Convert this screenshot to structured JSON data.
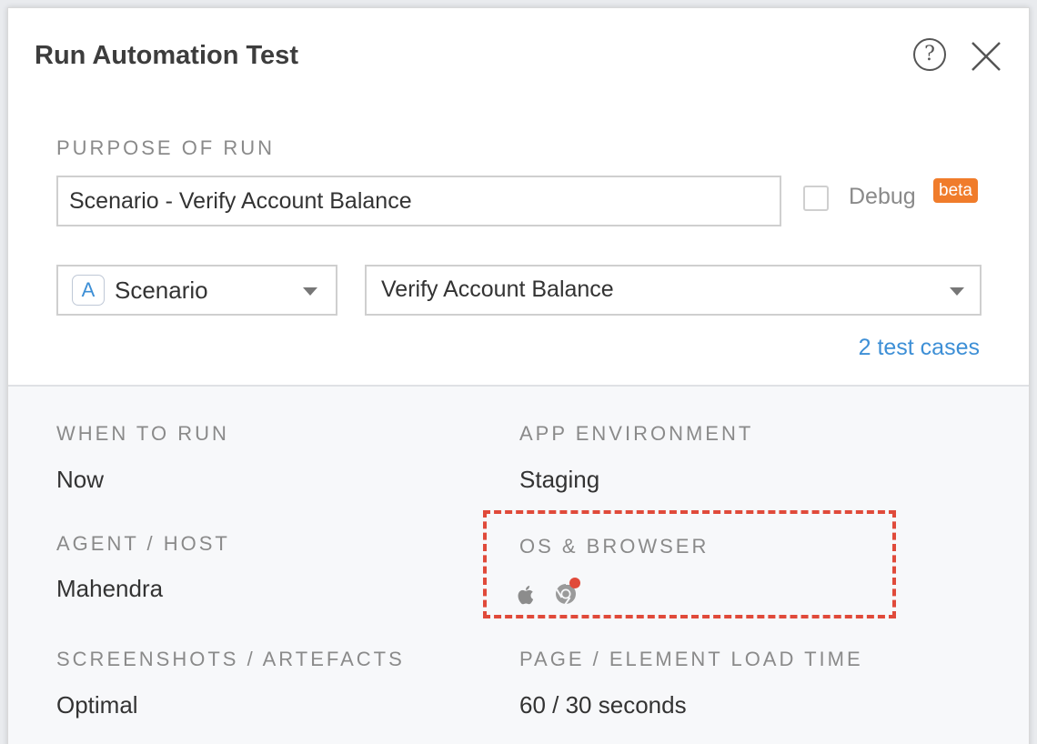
{
  "dialog": {
    "title": "Run Automation Test"
  },
  "purpose": {
    "label": "PURPOSE OF RUN",
    "value": "Scenario - Verify Account Balance"
  },
  "debug": {
    "label": "Debug",
    "badge": "beta",
    "checked": false
  },
  "type_select": {
    "icon_letter": "A",
    "value": "Scenario"
  },
  "scenario_select": {
    "value": "Verify Account Balance"
  },
  "test_cases_link": "2 test cases",
  "settings": {
    "when_to_run": {
      "label": "WHEN TO RUN",
      "value": "Now"
    },
    "app_environment": {
      "label": "APP ENVIRONMENT",
      "value": "Staging"
    },
    "agent_host": {
      "label": "AGENT / HOST",
      "value": "Mahendra"
    },
    "os_browser": {
      "label": "OS & BROWSER",
      "icons": [
        "apple-icon",
        "chrome-icon"
      ]
    },
    "screenshots": {
      "label": "SCREENSHOTS / ARTEFACTS",
      "value": "Optimal"
    },
    "load_time": {
      "label": "PAGE / ELEMENT LOAD TIME",
      "value": "60 / 30 seconds"
    }
  },
  "colors": {
    "accent": "#3d8fd6",
    "beta_badge": "#f07c2b",
    "highlight": "#e04a3a",
    "status_dot": "#e04a3a"
  }
}
